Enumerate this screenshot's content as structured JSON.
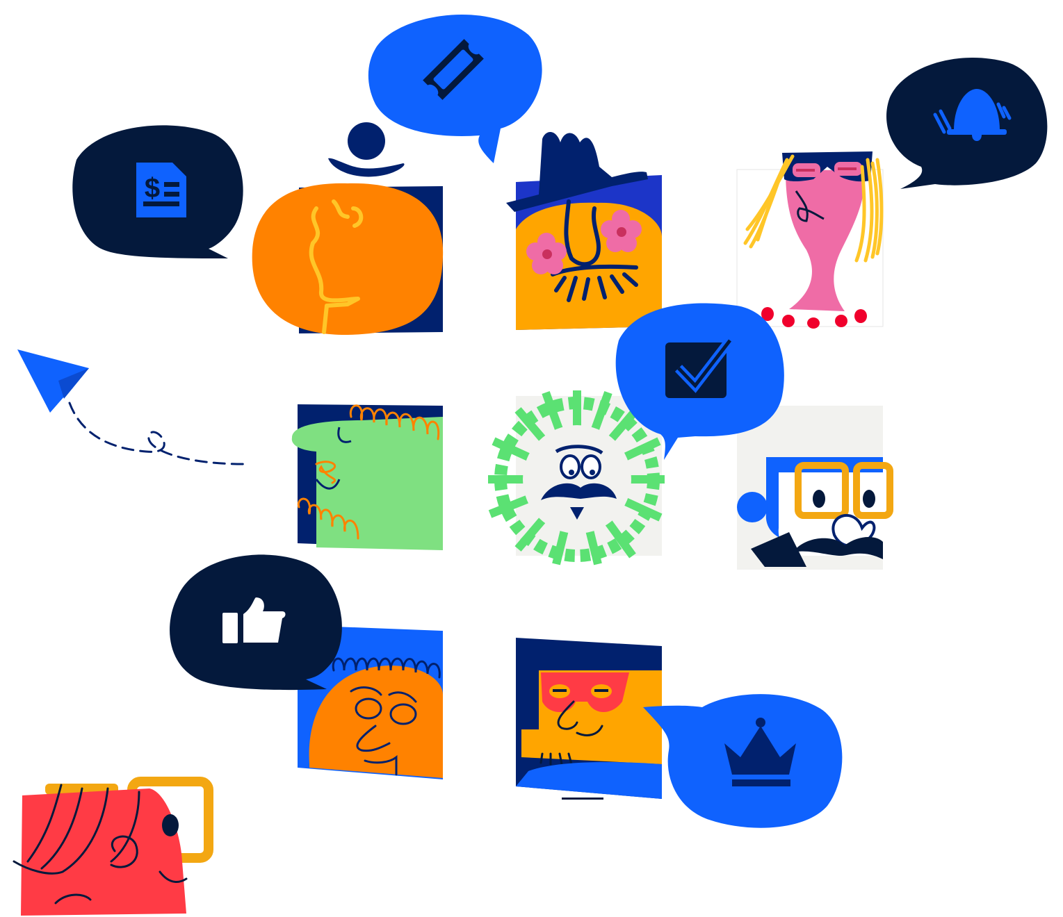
{
  "colors": {
    "navy": "#04193C",
    "dark_navy": "#0A1F4C",
    "indigo": "#01216E",
    "blue": "#0F62FE",
    "royal": "#1C35C8",
    "orange": "#FF8200",
    "amber": "#FFA500",
    "yellow": "#FFC628",
    "green": "#5BE173",
    "mint": "#7FE081",
    "pink": "#EF6CA6",
    "red": "#FF3B45",
    "paper": "#F2F2EF"
  },
  "characters": [
    {
      "id": "bowler-hat-man",
      "style": "orange round face with bowler hat"
    },
    {
      "id": "cowboy-man",
      "style": "amber face with fedora and flower cheeks"
    },
    {
      "id": "blonde-woman",
      "style": "pink face with glasses and long yellow hair"
    },
    {
      "id": "curly-green-man",
      "style": "green face with orange curly hair and beard"
    },
    {
      "id": "sunburst-man",
      "style": "face with green sunburst and mustache"
    },
    {
      "id": "glasses-man",
      "style": "blue hair with orange glasses and mustache"
    },
    {
      "id": "blue-hair-man",
      "style": "orange face with blue curly hair"
    },
    {
      "id": "red-glasses-man",
      "style": "amber face with red glasses"
    },
    {
      "id": "red-woman",
      "style": "red face with yellow glasses"
    }
  ],
  "bubbles": [
    {
      "id": "invoice",
      "icon": "invoice-dollar-icon"
    },
    {
      "id": "ticket",
      "icon": "ticket-icon"
    },
    {
      "id": "bell",
      "icon": "ringing-bell-icon"
    },
    {
      "id": "check",
      "icon": "checkbox-icon"
    },
    {
      "id": "thumb",
      "icon": "thumbs-up-icon"
    },
    {
      "id": "crown",
      "icon": "crown-icon"
    }
  ],
  "decorations": [
    {
      "id": "paper-plane",
      "icon": "paper-plane-icon"
    },
    {
      "id": "dashed-trail",
      "icon": "dashed-path"
    }
  ]
}
